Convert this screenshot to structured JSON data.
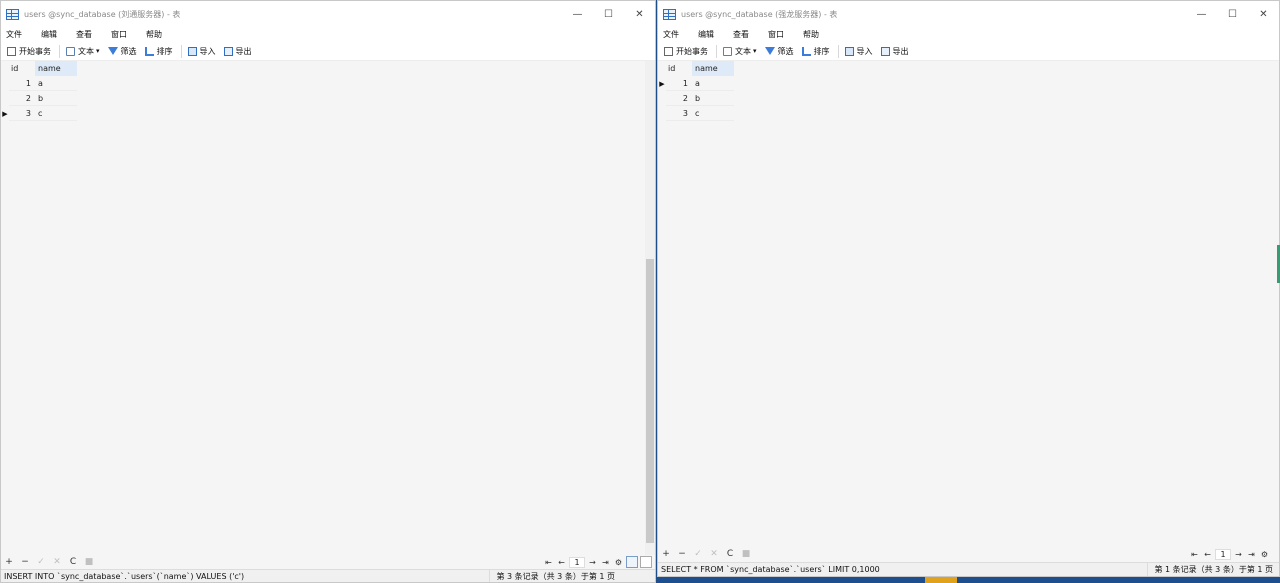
{
  "left": {
    "title": "users @sync_database (刘通服务器) - 表",
    "menu": [
      "文件",
      "编辑",
      "查看",
      "窗口",
      "帮助"
    ],
    "toolbar": {
      "begin_tx": "开始事务",
      "text": "文本",
      "filter": "筛选",
      "sort": "排序",
      "import": "导入",
      "export": "导出"
    },
    "columns": [
      "id",
      "name"
    ],
    "rows": [
      {
        "id": "1",
        "name": "a"
      },
      {
        "id": "2",
        "name": "b"
      },
      {
        "id": "3",
        "name": "c"
      }
    ],
    "current_row": 3,
    "page": "1",
    "status_sql": "INSERT INTO `sync_database`.`users`(`name`) VALUES ('c')",
    "status_records": "第 3 条记录（共 3 条）于第 1 页"
  },
  "right": {
    "title": "users @sync_database (强龙服务器) - 表",
    "menu": [
      "文件",
      "编辑",
      "查看",
      "窗口",
      "帮助"
    ],
    "toolbar": {
      "begin_tx": "开始事务",
      "text": "文本",
      "filter": "筛选",
      "sort": "排序",
      "import": "导入",
      "export": "导出"
    },
    "columns": [
      "id",
      "name"
    ],
    "rows": [
      {
        "id": "1",
        "name": "a"
      },
      {
        "id": "2",
        "name": "b"
      },
      {
        "id": "3",
        "name": "c"
      }
    ],
    "current_row": 1,
    "page": "1",
    "status_sql": "SELECT * FROM `sync_database`.`users` LIMIT 0,1000",
    "status_records": "第 1 条记录（共 3 条）于第 1 页"
  },
  "icons": {
    "window": "table-icon",
    "minimize": "minimize-icon",
    "maximize": "maximize-icon",
    "close": "close-icon"
  },
  "glyphs": {
    "minimize": "—",
    "maximize": "☐",
    "close": "✕",
    "caret": "▾",
    "row_pointer": "▶",
    "add": "+",
    "remove": "−",
    "apply": "✓",
    "cancel": "✕",
    "refresh": "C",
    "stop": "■",
    "first": "⇤",
    "prev": "←",
    "next": "→",
    "last": "⇥",
    "settings": "⚙"
  }
}
